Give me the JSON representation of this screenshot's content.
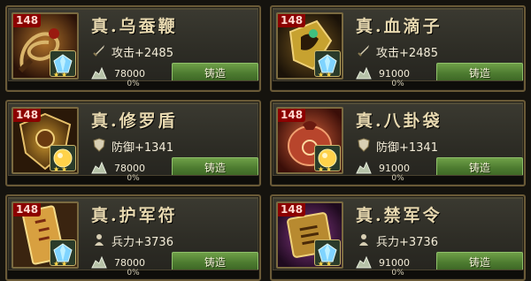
{
  "items": [
    {
      "level": "148",
      "name": "真.乌蚕鞭",
      "stat_type": "attack",
      "stat": "攻击+2485",
      "cost": "78000",
      "button": "铸造",
      "progress": "0%",
      "progress_value": 0,
      "stars": 2
    },
    {
      "level": "148",
      "name": "真.血滴子",
      "stat_type": "attack",
      "stat": "攻击+2485",
      "cost": "91000",
      "button": "铸造",
      "progress": "0%",
      "progress_value": 0,
      "stars": 2
    },
    {
      "level": "148",
      "name": "真.修罗盾",
      "stat_type": "defense",
      "stat": "防御+1341",
      "cost": "78000",
      "button": "铸造",
      "progress": "0%",
      "progress_value": 0,
      "stars": 2
    },
    {
      "level": "148",
      "name": "真.八卦袋",
      "stat_type": "defense",
      "stat": "防御+1341",
      "cost": "91000",
      "button": "铸造",
      "progress": "0%",
      "progress_value": 0,
      "stars": 2
    },
    {
      "level": "148",
      "name": "真.护军符",
      "stat_type": "troops",
      "stat": "兵力+3736",
      "cost": "78000",
      "button": "铸造",
      "progress": "0%",
      "progress_value": 0,
      "stars": 2
    },
    {
      "level": "148",
      "name": "真.禁军令",
      "stat_type": "troops",
      "stat": "兵力+3736",
      "cost": "91000",
      "button": "铸造",
      "progress": "0%",
      "progress_value": 0,
      "stars": 2
    }
  ],
  "colors": {
    "gem_blue": "#7fd4ff",
    "gem_gold": "#ffd24a",
    "level_badge": "#8b0000",
    "button_green": "#4d7b30"
  },
  "icons": {
    "attack": "sword-icon",
    "defense": "shield-icon",
    "troops": "soldier-icon",
    "cost": "silver-ore-icon"
  }
}
